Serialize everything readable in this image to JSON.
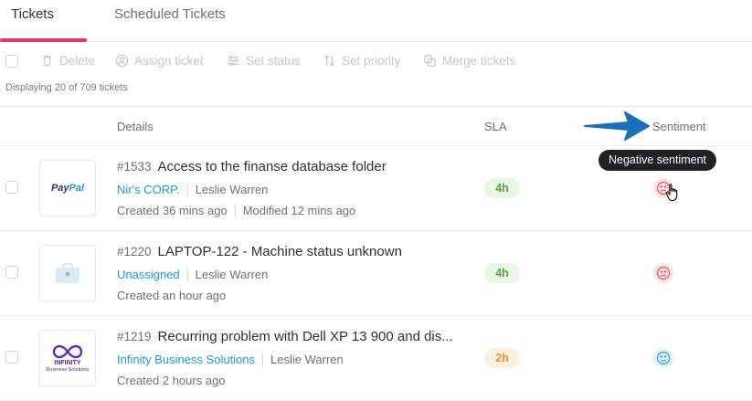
{
  "tabs": [
    {
      "label": "Tickets",
      "active": true
    },
    {
      "label": "Scheduled Tickets",
      "active": false
    }
  ],
  "toolbar": {
    "delete": "Delete",
    "assign": "Assign ticket",
    "status": "Set status",
    "priority": "Set priority",
    "merge": "Merge tickets"
  },
  "count_text": "Displaying 20 of 709 tickets",
  "columns": {
    "details": "Details",
    "sla": "SLA",
    "sentiment": "Sentiment"
  },
  "tooltip": "Negative sentiment",
  "tickets": [
    {
      "number": "#1533",
      "title": "Access to the finanse database folder",
      "company": "Nir's CORP.",
      "agent": "Leslie Warren",
      "created": "Created 36 mins ago",
      "modified": "Modified 12 mins ago",
      "sla": "4h",
      "sentiment": "negative",
      "logo": {
        "pay": "Pay",
        "pal": "Pal"
      }
    },
    {
      "number": "#1220",
      "title": "LAPTOP-122 - Machine status unknown",
      "company": "Unassigned",
      "agent": "Leslie Warren",
      "created": "Created an hour ago",
      "sla": "4h",
      "sentiment": "negative",
      "logo": "briefcase-icon"
    },
    {
      "number": "#1219",
      "title": "Recurring problem with Dell XP 13 900 and dis...",
      "company": "Infinity Business Solutions",
      "agent": "Leslie Warren",
      "created": "Created 2 hours ago",
      "sla": "2h",
      "sentiment": "neutral",
      "logo": {
        "name": "INFINITY",
        "sub": "Business Solutions"
      }
    }
  ],
  "colors": {
    "accent": "#e4316f",
    "link": "#1e9ad6",
    "arrow": "#1d6fb8",
    "sla_green": "#5aa341",
    "sla_orange": "#e3962f"
  }
}
